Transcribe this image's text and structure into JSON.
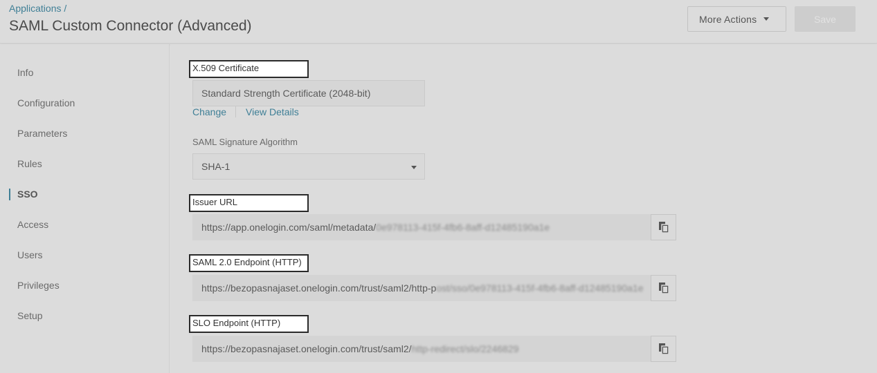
{
  "header": {
    "breadcrumb": "Applications /",
    "title": "SAML Custom Connector (Advanced)",
    "more_actions_label": "More Actions",
    "save_label": "Save"
  },
  "sidebar": {
    "items": [
      {
        "label": "Info"
      },
      {
        "label": "Configuration"
      },
      {
        "label": "Parameters"
      },
      {
        "label": "Rules"
      },
      {
        "label": "SSO",
        "active": true
      },
      {
        "label": "Access"
      },
      {
        "label": "Users"
      },
      {
        "label": "Privileges"
      },
      {
        "label": "Setup"
      }
    ]
  },
  "certificate": {
    "label": "X.509 Certificate",
    "value": "Standard Strength Certificate (2048-bit)",
    "change_link": "Change",
    "details_link": "View Details"
  },
  "signature": {
    "label": "SAML Signature Algorithm",
    "selected": "SHA-1"
  },
  "issuer": {
    "label": "Issuer URL",
    "url_visible": "https://app.onelogin.com/saml/metadata/",
    "url_blurred": "0e978113-415f-4fb6-8aff-d12485190a1e"
  },
  "saml_endpoint": {
    "label": "SAML 2.0 Endpoint (HTTP)",
    "url_visible": "https://bezopasnajaset.onelogin.com/trust/saml2/http-p",
    "url_blurred": "ost/sso/0e978113-415f-4fb6-8aff-d12485190a1e"
  },
  "slo_endpoint": {
    "label": "SLO Endpoint (HTTP)",
    "url_visible": "https://bezopasnajaset.onelogin.com/trust/saml2/",
    "url_blurred": "http-redirect/slo/2246829"
  },
  "icons": {
    "copy": "copy-icon",
    "dropdown": "chevron-down-icon"
  },
  "colors": {
    "link": "#3f7f96",
    "background": "#dcdcdc"
  }
}
